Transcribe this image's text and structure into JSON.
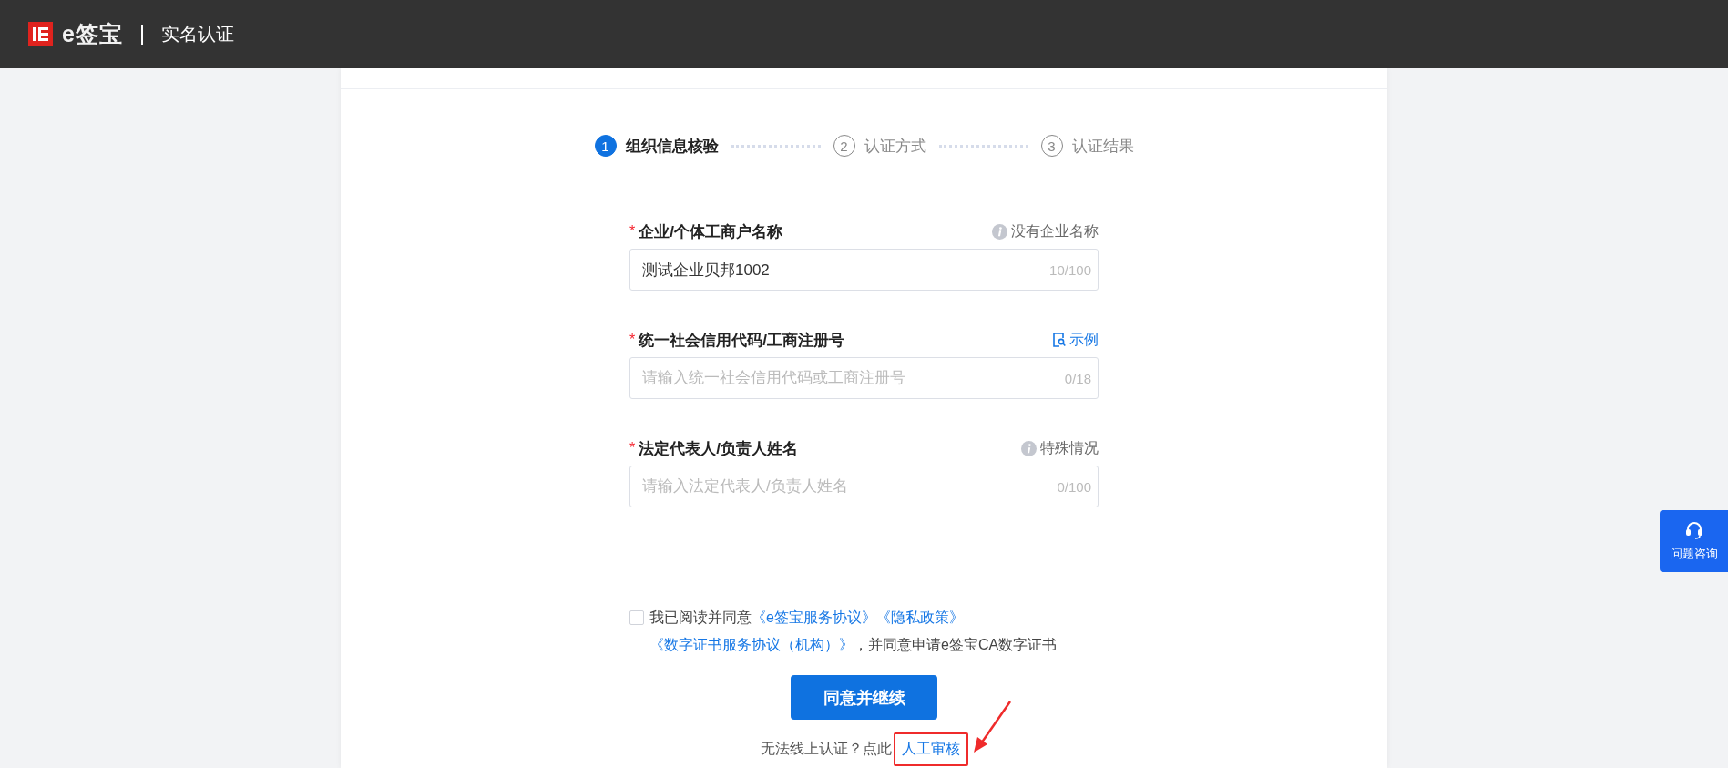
{
  "header": {
    "logo_text": "e签宝",
    "page_title": "实名认证"
  },
  "steps": [
    {
      "number": "1",
      "label": "组织信息核验",
      "selected": true
    },
    {
      "number": "2",
      "label": "认证方式",
      "selected": false
    },
    {
      "number": "3",
      "label": "认证结果",
      "selected": false
    }
  ],
  "fields": [
    {
      "label": "企业/个体工商户名称",
      "required_mark": "*",
      "hint": {
        "kind": "info",
        "text": "没有企业名称"
      },
      "value": "测试企业贝邦1002",
      "counter": "10/100"
    },
    {
      "label": "统一社会信用代码/工商注册号",
      "required_mark": "*",
      "hint": {
        "kind": "example",
        "text": "示例"
      },
      "placeholder": "请输入统一社会信用代码或工商注册号",
      "counter": "0/18"
    },
    {
      "label": "法定代表人/负责人姓名",
      "required_mark": "*",
      "hint": {
        "kind": "info",
        "text": "特殊情况"
      },
      "placeholder": "请输入法定代表人/负责人姓名",
      "counter": "0/100"
    }
  ],
  "agreement": {
    "checked": false,
    "parts": [
      {
        "kind": "text",
        "text": "我已阅读并同意"
      },
      {
        "kind": "link",
        "text": "《e签宝服务协议》"
      },
      {
        "kind": "link",
        "text": "《隐私政策》"
      },
      {
        "kind": "link",
        "text": "《数字证书服务协议（机构）》"
      },
      {
        "kind": "text",
        "text": "，并同意申请e签宝CA数字证书"
      }
    ]
  },
  "submit_button": "同意并继续",
  "manual_review": {
    "prompt": "无法线上认证？点此",
    "link": "人工审核"
  },
  "help_button": "问题咨询"
}
